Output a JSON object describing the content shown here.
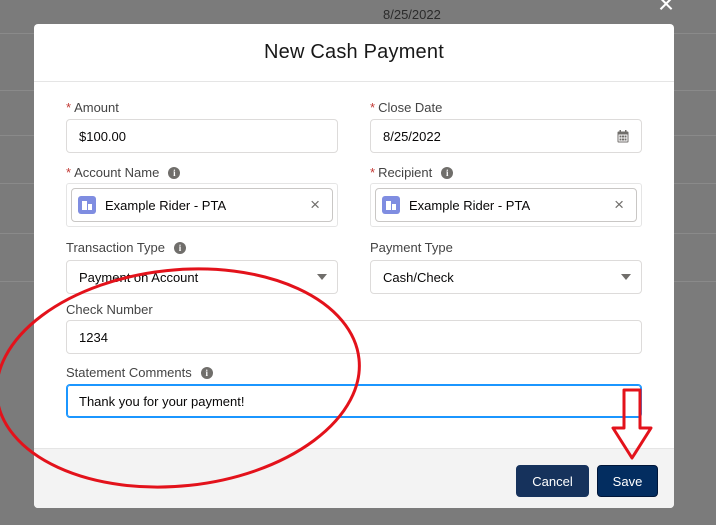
{
  "background": {
    "date_text": "8/25/2022"
  },
  "modal": {
    "title": "New Cash Payment",
    "fields": {
      "amount": {
        "label": "Amount",
        "value": "$100.00",
        "required": true
      },
      "close_date": {
        "label": "Close Date",
        "value": "8/25/2022",
        "required": true
      },
      "account_name": {
        "label": "Account Name",
        "value": "Example Rider - PTA",
        "required": true
      },
      "recipient": {
        "label": "Recipient",
        "value": "Example Rider - PTA",
        "required": true
      },
      "transaction_type": {
        "label": "Transaction Type",
        "value": "Payment on Account"
      },
      "payment_type": {
        "label": "Payment Type",
        "value": "Cash/Check"
      },
      "check_number": {
        "label": "Check Number",
        "value": "1234"
      },
      "statement_comments": {
        "label": "Statement Comments",
        "value": "Thank you for your payment!"
      }
    },
    "required_marker": "*",
    "info_glyph": "i",
    "close_glyph": "×",
    "icons": {
      "close": "close-icon",
      "info": "info-icon",
      "calendar": "calendar-icon",
      "account": "account-icon",
      "clear": "clear-icon",
      "dropdown": "chevron-down-icon"
    },
    "footer": {
      "cancel_label": "Cancel",
      "save_label": "Save"
    }
  },
  "colors": {
    "accent": "#1b96ff",
    "button_dark": "#032d60",
    "annotation_red": "#e3121b",
    "required": "#c23934",
    "account_icon": "#7f8de1"
  }
}
